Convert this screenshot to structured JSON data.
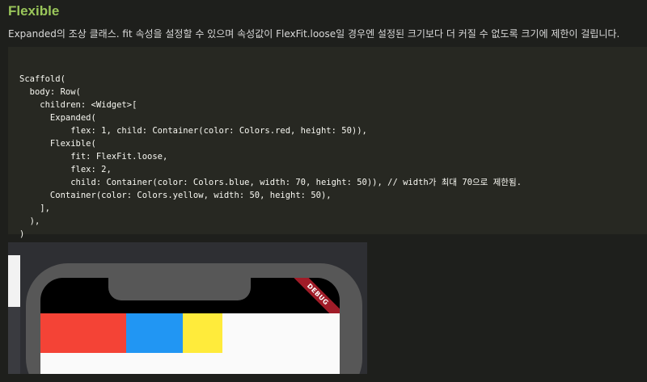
{
  "heading": "Flexible",
  "description": "Expanded의 조상 클래스. fit 속성을 설정할 수 있으며 속성값이 FlexFit.loose일 경우엔 설정된 크기보다 더 커질 수 없도록 크기에 제한이 걸립니다.",
  "code_lines": [
    "Scaffold(",
    "  body: Row(",
    "    children: <Widget>[",
    "      Expanded(",
    "          flex: 1, child: Container(color: Colors.red, height: 50)),",
    "      Flexible(",
    "          fit: FlexFit.loose,",
    "          flex: 2,",
    "          child: Container(color: Colors.blue, width: 70, height: 50)), // width가 최대 70으로 제한됨.",
    "      Container(color: Colors.yellow, width: 50, height: 50),",
    "    ],",
    "  ),",
    ")"
  ],
  "preview": {
    "debug_banner": "DEBUG",
    "boxes": [
      {
        "name": "red",
        "color": "#f44336"
      },
      {
        "name": "blue",
        "color": "#2196f3"
      },
      {
        "name": "yellow",
        "color": "#ffeb3b"
      }
    ]
  }
}
